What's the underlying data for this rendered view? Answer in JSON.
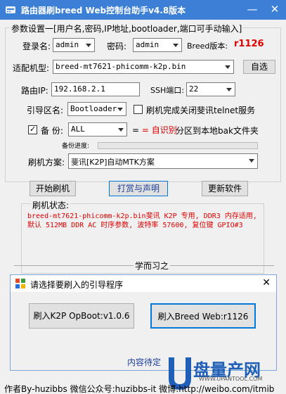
{
  "window": {
    "title": "路由器刷breed Web控制台助手v4.8版本",
    "minimize_label": "—",
    "close_label": "✕"
  },
  "params": {
    "group_title": "参数设置一[用户名,密码,IP地址,bootloader,端口可手动输入]",
    "login_label": "登录名:",
    "login_value": "admin",
    "password_label": "密码:",
    "password_value": "admin",
    "breed_version_label": "Breed版本:",
    "breed_version_value": "r1126",
    "model_label": "适配机型:",
    "model_value": "breed-mt7621-phicomm-k2p.bin",
    "auto_select_label": "自选",
    "router_ip_label": "路由IP:",
    "router_ip_value": "192.168.2.1",
    "ssh_port_label": "SSH端口:",
    "ssh_port_value": "22",
    "boot_partition_label": "引导区名:",
    "boot_partition_value": "Bootloader",
    "close_telnet_label": "刷机完成关闭斐讯telnet服务",
    "close_telnet_checked": false,
    "backup_label": "备  份:",
    "backup_checked": true,
    "backup_value": "ALL",
    "auto_detect_label": "= 自识别",
    "backup_to_local_label": "分区到本地bak文件夹",
    "backup_progress_label": "备份进度:",
    "backup_progress": 0,
    "flash_plan_label": "刷机方案:",
    "flash_plan_value": "斐讯[K2P]自动MTK方案"
  },
  "actions": {
    "start_flash": "开始刷机",
    "reward": "打赏与声明",
    "update": "更新软件"
  },
  "status": {
    "group_title": "刷机状态:",
    "message": "breed-mt7621-phicomm-k2p.bin斐讯 K2P 专用, DDR3 内存适用, 默认 512MB DDR AC 时序参数, 波特率 57600, 复位键 GPIO#3"
  },
  "separator_text": "学而习之",
  "dialog": {
    "title": "请选择要刷入的引导程序",
    "close_label": "✕",
    "button_k2p": "刷入K2P OpBoot:v1.0.6",
    "button_breed": "刷入Breed Web:r1126",
    "pending_text": "内容待定"
  },
  "footer": {
    "text": "作者By-huzibbs 微信公众号:huzibbs-it 微博:http://weibo.com/itmib"
  },
  "watermark": {
    "brand": "盘量产网",
    "url": "WWW.UPANTOOL.COM"
  },
  "colors": {
    "titlebar": "#3c7fd6",
    "accent_red": "#e00000",
    "focus_blue": "#0078d7"
  }
}
